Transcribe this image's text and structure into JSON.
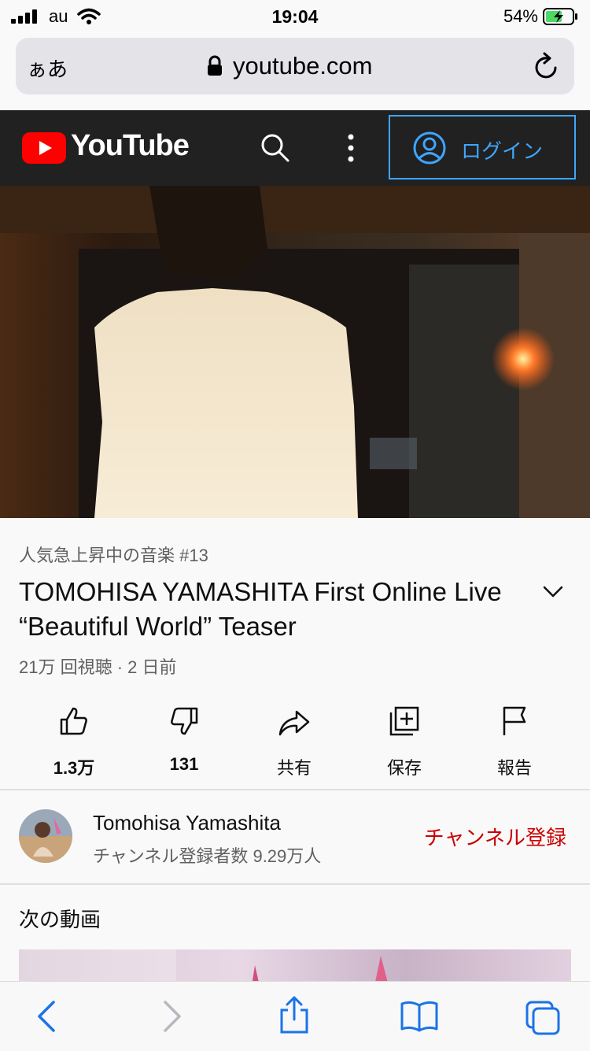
{
  "status": {
    "carrier": "au",
    "time": "19:04",
    "battery": "54%"
  },
  "browser": {
    "aa": "ぁあ",
    "domain": "youtube.com"
  },
  "header": {
    "wordmark": "YouTube",
    "login_label": "ログイン",
    "accent": "#3ea6ff"
  },
  "video_info": {
    "trend": "人気急上昇中の音楽 #13",
    "title": "TOMOHISA YAMASHITA First Online Live “Beautiful World” Teaser",
    "meta": "21万 回視聴 · 2 日前"
  },
  "actions": [
    {
      "label": "1.3万",
      "icon": "thumbs-up-icon"
    },
    {
      "label": "131",
      "icon": "thumbs-down-icon"
    },
    {
      "label": "共有",
      "icon": "share-icon"
    },
    {
      "label": "保存",
      "icon": "add-to-playlist-icon"
    },
    {
      "label": "報告",
      "icon": "flag-icon"
    }
  ],
  "channel": {
    "name": "Tomohisa Yamashita",
    "subs": "チャンネル登録者数 9.29万人",
    "subscribe": "チャンネル登録",
    "subscribe_color": "#cc0000"
  },
  "next": {
    "heading": "次の動画"
  }
}
